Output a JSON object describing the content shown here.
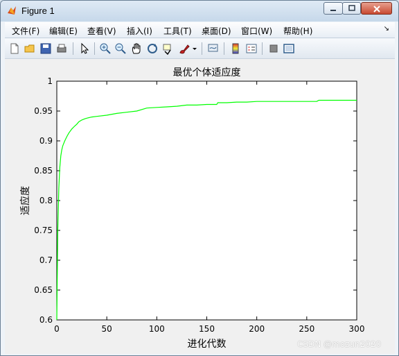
{
  "window": {
    "title": "Figure 1",
    "icon": "matlab-icon"
  },
  "menu": {
    "items": [
      "文件(F)",
      "编辑(E)",
      "查看(V)",
      "插入(I)",
      "工具(T)",
      "桌面(D)",
      "窗口(W)",
      "帮助(H)"
    ]
  },
  "toolbar": {
    "icons": [
      "new-icon",
      "open-icon",
      "save-icon",
      "print-icon",
      "pointer-icon",
      "zoom-in-icon",
      "zoom-out-icon",
      "pan-icon",
      "rotate-icon",
      "data-cursor-icon",
      "brush-icon",
      "link-icon",
      "colorbar-icon",
      "legend-icon",
      "hide-plot-tools-icon",
      "show-plot-tools-icon"
    ]
  },
  "chart_data": {
    "type": "line",
    "title": "最优个体适应度",
    "xlabel": "进化代数",
    "ylabel": "适应度",
    "xlim": [
      0,
      300
    ],
    "ylim": [
      0.6,
      1
    ],
    "xticks": [
      "0",
      "50",
      "100",
      "150",
      "200",
      "250",
      "300"
    ],
    "yticks": [
      "0.6",
      "0.65",
      "0.7",
      "0.75",
      "0.8",
      "0.85",
      "0.9",
      "0.95",
      "1"
    ],
    "line_color": "#00ff00",
    "series": [
      {
        "x": [
          0,
          1,
          2,
          3,
          4,
          5,
          6,
          8,
          10,
          12,
          15,
          18,
          20,
          22,
          25,
          28,
          30,
          35,
          40,
          50,
          60,
          70,
          80,
          90,
          100,
          110,
          120,
          130,
          140,
          150,
          160,
          161,
          170,
          180,
          190,
          200,
          210,
          220,
          230,
          240,
          250,
          260,
          262,
          270,
          280,
          290,
          300
        ],
        "y": [
          0.6,
          0.75,
          0.82,
          0.855,
          0.875,
          0.885,
          0.892,
          0.9,
          0.907,
          0.913,
          0.92,
          0.925,
          0.928,
          0.932,
          0.935,
          0.937,
          0.938,
          0.94,
          0.941,
          0.943,
          0.946,
          0.948,
          0.95,
          0.955,
          0.956,
          0.957,
          0.958,
          0.96,
          0.96,
          0.961,
          0.961,
          0.964,
          0.964,
          0.965,
          0.965,
          0.966,
          0.966,
          0.966,
          0.966,
          0.966,
          0.966,
          0.966,
          0.968,
          0.968,
          0.968,
          0.968,
          0.968
        ]
      }
    ]
  },
  "watermark": "CSDN @mozun2020"
}
